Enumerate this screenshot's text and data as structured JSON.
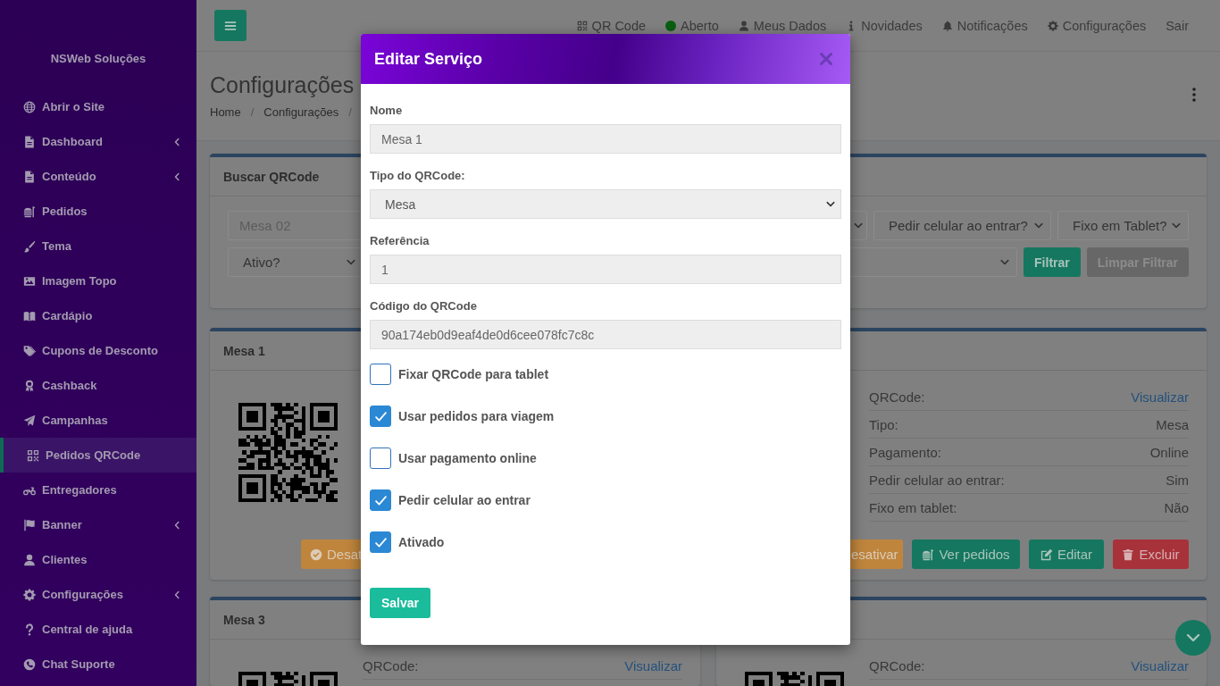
{
  "sidebar": {
    "brand": "NSWeb Soluções",
    "items": [
      {
        "label": "Abrir o Site",
        "submenu": false,
        "selected": false
      },
      {
        "label": "Dashboard",
        "submenu": true,
        "selected": false
      },
      {
        "label": "Conteúdo",
        "submenu": true,
        "selected": false
      },
      {
        "label": "Pedidos",
        "submenu": false,
        "selected": false
      },
      {
        "label": "Tema",
        "submenu": false,
        "selected": false
      },
      {
        "label": "Imagem Topo",
        "submenu": false,
        "selected": false
      },
      {
        "label": "Cardápio",
        "submenu": false,
        "selected": false
      },
      {
        "label": "Cupons de Desconto",
        "submenu": false,
        "selected": false
      },
      {
        "label": "Cashback",
        "submenu": false,
        "selected": false
      },
      {
        "label": "Campanhas",
        "submenu": false,
        "selected": false
      },
      {
        "label": "Pedidos QRCode",
        "submenu": false,
        "selected": true
      },
      {
        "label": "Entregadores",
        "submenu": false,
        "selected": false
      },
      {
        "label": "Banner",
        "submenu": true,
        "selected": false
      },
      {
        "label": "Clientes",
        "submenu": false,
        "selected": false
      },
      {
        "label": "Configurações",
        "submenu": true,
        "selected": false
      },
      {
        "label": "Central de ajuda",
        "submenu": false,
        "selected": false
      },
      {
        "label": "Chat Suporte",
        "submenu": false,
        "selected": false
      }
    ]
  },
  "topbar": {
    "nav": [
      {
        "label": "QR Code"
      },
      {
        "label": "Aberto",
        "color": "#0b5e12"
      },
      {
        "label": "Meus Dados"
      },
      {
        "label": "Novidades"
      },
      {
        "label": "Notificações"
      },
      {
        "label": "Configurações"
      },
      {
        "label": "Sair"
      }
    ]
  },
  "page_header": {
    "title": "Configurações",
    "breadcrumb": [
      {
        "label": "Home",
        "separator": "/"
      },
      {
        "label": "Configurações",
        "separator": "/"
      }
    ]
  },
  "search_card": {
    "title": "Buscar QRCode",
    "rows": [
      {
        "fields": [
          {
            "kind": "input",
            "placeholder": "Mesa 02"
          },
          {
            "kind": "select"
          },
          {
            "kind": "select",
            "value": "Pedir celular ao entrar?"
          },
          {
            "kind": "select",
            "value": "Fixo em Tablet?"
          }
        ]
      },
      {
        "fields": [
          {
            "kind": "select",
            "value": "Ativo?"
          },
          {
            "kind": "select"
          }
        ],
        "buttons": [
          {
            "label": "Filtrar",
            "disabled": false
          },
          {
            "label": "Limpar Filtrar",
            "disabled": true
          }
        ]
      }
    ]
  },
  "cards": [
    {
      "title": "Mesa 1",
      "qr_code": true,
      "buttons": [
        {
          "label": "Desat",
          "kind": "deactivate",
          "show_icon": true
        }
      ]
    },
    {
      "rows": [
        {
          "label": "QRCode:",
          "value": "Visualizar",
          "link": true
        },
        {
          "label": "Tipo:",
          "value": "Mesa",
          "link": false
        },
        {
          "label": "Pagamento:",
          "value": "Online",
          "link": false
        },
        {
          "label": "Pedir celular ao entrar:",
          "value": "Sim",
          "link": false
        },
        {
          "label": "Fixo em tablet:",
          "value": "Não",
          "link": false
        }
      ],
      "buttons": [
        {
          "label": "esativar",
          "kind": "deactivate",
          "show_icon": false
        },
        {
          "label": "Ver pedidos",
          "kind": "orders",
          "show_icon": true
        },
        {
          "label": "Editar",
          "kind": "edit",
          "show_icon": true
        },
        {
          "label": "Excluir",
          "kind": "delete",
          "show_icon": true
        }
      ]
    },
    {
      "title": "Mesa 3",
      "qr_code": true,
      "rows": [
        {
          "label": "QRCode:",
          "value": "Visualizar",
          "link": true
        }
      ]
    },
    {
      "qr_code": true,
      "rows": [
        {
          "label": "QRCode:",
          "value": "Visualizar",
          "link": true
        }
      ]
    }
  ],
  "modal": {
    "title": "Editar Serviço",
    "fields": [
      {
        "label": "Nome",
        "kind": "input",
        "value": "Mesa 1"
      },
      {
        "label": "Tipo do QRCode:",
        "kind": "select",
        "value": "Mesa"
      },
      {
        "label": "Referência",
        "kind": "input",
        "value": "1"
      },
      {
        "label": "Código do QRCode",
        "kind": "input",
        "value": "90a174eb0d9eaf4de0d6cee078fc7c8c"
      }
    ],
    "checkboxes": [
      {
        "label": "Fixar QRCode para tablet",
        "checked": false
      },
      {
        "label": "Usar pedidos para viagem",
        "checked": true
      },
      {
        "label": "Usar pagamento online",
        "checked": false
      },
      {
        "label": "Pedir celular ao entrar",
        "checked": true
      },
      {
        "label": "Ativado",
        "checked": true
      }
    ],
    "submit": "Salvar"
  }
}
